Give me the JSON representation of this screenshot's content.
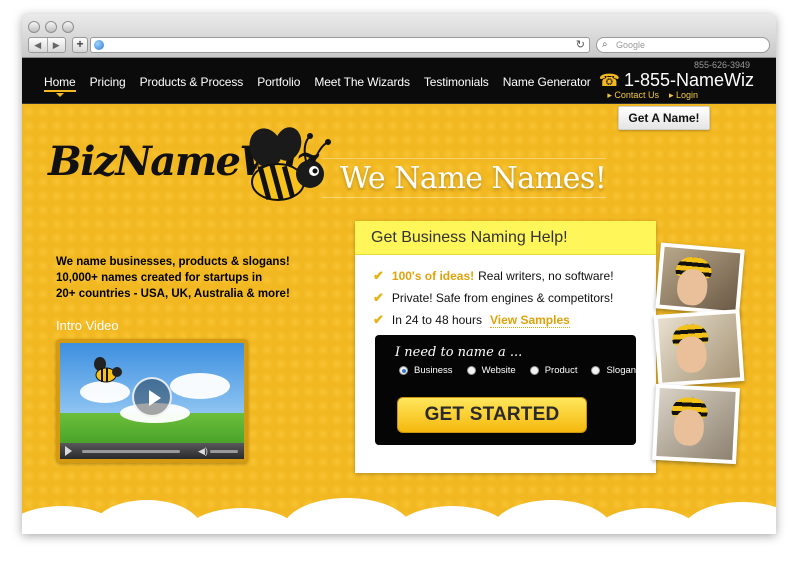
{
  "browser": {
    "back_glyph": "◀",
    "forward_glyph": "▶",
    "add_glyph": "+",
    "reload_glyph": "↻",
    "search_glyph": "⌕",
    "search_placeholder": "Google"
  },
  "header": {
    "nav": [
      {
        "label": "Home"
      },
      {
        "label": "Pricing"
      },
      {
        "label": "Products & Process"
      },
      {
        "label": "Portfolio"
      },
      {
        "label": "Meet The Wizards"
      },
      {
        "label": "Testimonials"
      },
      {
        "label": "Name Generator"
      }
    ],
    "phone_small": "855-626-3949",
    "phone_icon": "☎",
    "phone_big": "1-855-NameWiz",
    "contact_us": "▸ Contact Us",
    "login": "▸ Login",
    "get_name": "Get A Name!"
  },
  "hero": {
    "logo": "BizNameWiz",
    "logo_tm": "TM",
    "tagline": "We Name Names!"
  },
  "intro": {
    "lines": [
      "We name businesses, products & slogans!",
      "10,000+ names created for startups in",
      "20+ countries - USA, UK, Australia & more!"
    ],
    "video_label": "Intro Video",
    "volume_glyph": "◀)"
  },
  "panel": {
    "title": "Get Business Naming Help!",
    "check_glyph": "✔",
    "bullet1_highlight": "100's of ideas!",
    "bullet1_rest": "Real writers, no software!",
    "bullet2": "Private! Safe from engines & competitors!",
    "bullet3": "In 24 to 48 hours",
    "view_samples": "View Samples",
    "question": "I need to name a ...",
    "options": [
      "Business",
      "Website",
      "Product",
      "Slogan"
    ],
    "selected_option": "Business",
    "cta": "GET STARTED"
  },
  "colors": {
    "honey": "#f2b822",
    "nav_bg": "#0b0b0b",
    "panel_head": "#fff65a",
    "accent": "#e0a20a"
  }
}
